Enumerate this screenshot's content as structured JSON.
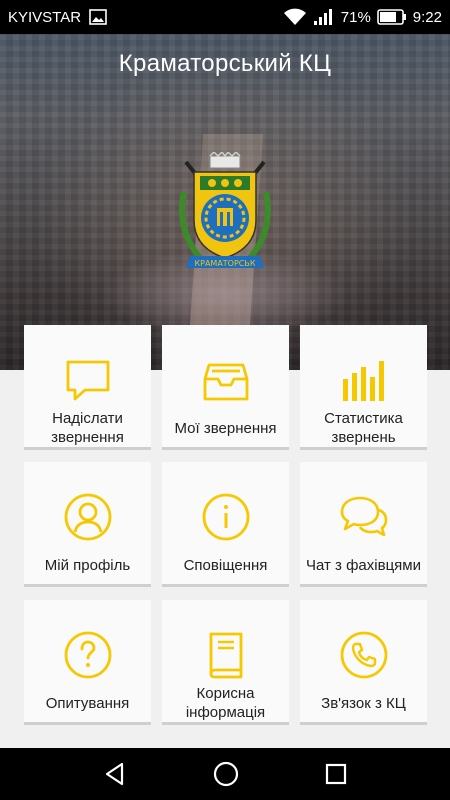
{
  "status_bar": {
    "carrier": "KYIVSTAR",
    "battery_percent": "71%",
    "time": "9:22"
  },
  "header": {
    "title": "Краматорський КЦ",
    "emblem_text": "КРАМАТОРСЬК"
  },
  "accent_color": "#f5c800",
  "menu": [
    {
      "label": "Надіслати звернення",
      "icon": "message-icon"
    },
    {
      "label": "Мої звернення",
      "icon": "inbox-tray-icon"
    },
    {
      "label": "Статистика звернень",
      "icon": "bar-chart-icon"
    },
    {
      "label": "Мій профіль",
      "icon": "user-profile-icon"
    },
    {
      "label": "Сповіщення",
      "icon": "info-icon"
    },
    {
      "label": "Чат з фахівцями",
      "icon": "chat-bubbles-icon"
    },
    {
      "label": "Опитування",
      "icon": "question-icon"
    },
    {
      "label": "Корисна інформація",
      "icon": "book-icon"
    },
    {
      "label": "Зв'язок з КЦ",
      "icon": "phone-icon"
    }
  ]
}
